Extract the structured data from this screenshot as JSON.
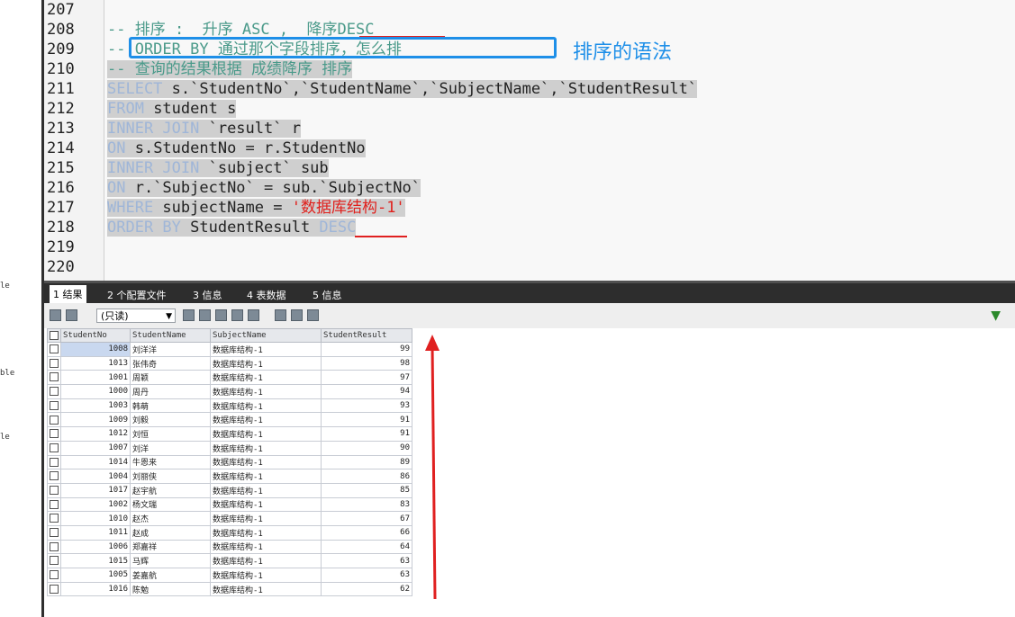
{
  "left_fragments": [
    "le",
    "ble",
    "le"
  ],
  "editor": {
    "lines": [
      {
        "no": "207"
      },
      {
        "no": "208"
      },
      {
        "no": "209"
      },
      {
        "no": "210"
      },
      {
        "no": "211"
      },
      {
        "no": "212"
      },
      {
        "no": "213"
      },
      {
        "no": "214"
      },
      {
        "no": "215"
      },
      {
        "no": "216"
      },
      {
        "no": "217"
      },
      {
        "no": "218"
      },
      {
        "no": "219"
      },
      {
        "no": "220"
      }
    ],
    "code": {
      "l208": {
        "a": "-- 排序 :  升序 ASC ,  降序DESC"
      },
      "l209": {
        "a": "-- ORDER BY 通过那个字段排序，怎么排"
      },
      "l210": {
        "a": "-- 查询的结果根据 成绩降序 排序"
      },
      "l211": {
        "kw": "SELECT",
        "rest": " s.`StudentNo`,`StudentName`,`SubjectName`,`StudentResult`"
      },
      "l212": {
        "kw": "FROM",
        "rest": " student s"
      },
      "l213": {
        "kw": "INNER JOIN",
        "rest": " `result` r"
      },
      "l214": {
        "kw": "ON",
        "rest": " s.StudentNo = r.StudentNo"
      },
      "l215": {
        "kw": "INNER JOIN",
        "rest": " `subject` sub"
      },
      "l216": {
        "kw": "ON",
        "rest": " r.`SubjectNo` = sub.`SubjectNo`"
      },
      "l217": {
        "kw": "WHERE",
        "rest": " subjectName = ",
        "str": "'数据库结构-1'"
      },
      "l218": {
        "kw": "ORDER BY",
        "rest": " StudentResult ",
        "kw2": "DESC"
      }
    },
    "annotation": "排序的语法"
  },
  "tabs": [
    {
      "label": "1 结果"
    },
    {
      "label": "2 个配置文件"
    },
    {
      "label": "3 信息"
    },
    {
      "label": "4 表数据"
    },
    {
      "label": "5 信息"
    }
  ],
  "toolbar": {
    "select_value": "(只读)"
  },
  "grid": {
    "columns": [
      "StudentNo",
      "StudentName",
      "SubjectName",
      "StudentResult"
    ],
    "rows": [
      [
        "1008",
        "刘洋洋",
        "数据库结构-1",
        "99"
      ],
      [
        "1013",
        "张伟奇",
        "数据库结构-1",
        "98"
      ],
      [
        "1001",
        "周颖",
        "数据库结构-1",
        "97"
      ],
      [
        "1000",
        "周丹",
        "数据库结构-1",
        "94"
      ],
      [
        "1003",
        "韩萌",
        "数据库结构-1",
        "93"
      ],
      [
        "1009",
        "刘毅",
        "数据库结构-1",
        "91"
      ],
      [
        "1012",
        "刘恒",
        "数据库结构-1",
        "91"
      ],
      [
        "1007",
        "刘洋",
        "数据库结构-1",
        "90"
      ],
      [
        "1014",
        "牛恩来",
        "数据库结构-1",
        "89"
      ],
      [
        "1004",
        "刘丽侠",
        "数据库结构-1",
        "86"
      ],
      [
        "1017",
        "赵宇航",
        "数据库结构-1",
        "85"
      ],
      [
        "1002",
        "杨文瑞",
        "数据库结构-1",
        "83"
      ],
      [
        "1010",
        "赵杰",
        "数据库结构-1",
        "67"
      ],
      [
        "1011",
        "赵成",
        "数据库结构-1",
        "66"
      ],
      [
        "1006",
        "郑嘉祥",
        "数据库结构-1",
        "64"
      ],
      [
        "1015",
        "马辉",
        "数据库结构-1",
        "63"
      ],
      [
        "1005",
        "姜嘉航",
        "数据库结构-1",
        "63"
      ],
      [
        "1016",
        "陈勉",
        "数据库结构-1",
        "62"
      ]
    ]
  },
  "colors": {
    "annotation_blue": "#1e8fe8",
    "markup_red": "#e02020",
    "string_red": "#e0201c"
  }
}
